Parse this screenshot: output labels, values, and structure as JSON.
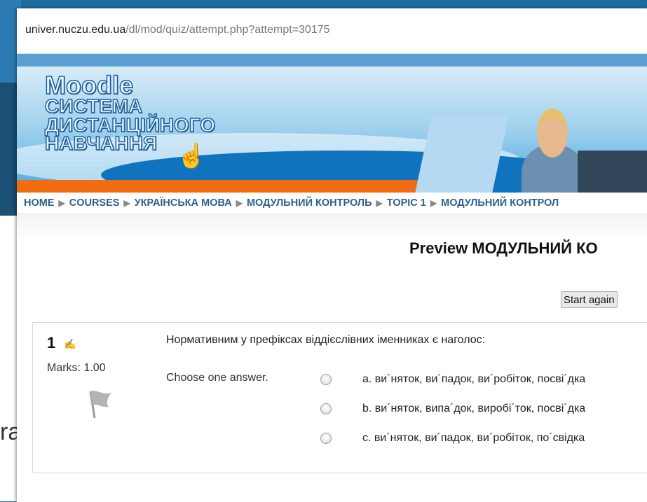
{
  "browser": {
    "url_host": "univer.nuczu.edu.ua",
    "url_path": "/dl/mod/quiz/attempt.php?attempt=30175"
  },
  "banner": {
    "logo_line1": "Moodle",
    "logo_line2": "СИСТЕМА",
    "logo_line3": "ДИСТАНЦІЙНОГО",
    "logo_line4": "НАВЧАННЯ"
  },
  "breadcrumb": [
    "HOME",
    "COURSES",
    "УКРАЇНСЬКА МОВА",
    "МОДУЛЬНИЙ КОНТРОЛЬ",
    "TOPIC 1",
    "МОДУЛЬНИЙ КОНТРОЛ"
  ],
  "page": {
    "title": "Preview МОДУЛЬНИЙ КО",
    "start_again_label": "Start again"
  },
  "question": {
    "number": "1",
    "marks": "Marks: 1.00",
    "text": "Нормативним у префіксах віддієслівних іменниках є наголос:",
    "prompt": "Choose one answer.",
    "options": [
      "a. ви´няток, ви´падок, ви´робіток, посві´дка",
      "b. ви´няток, випа´док, виробі´ток, посві´дка",
      "c. ви´няток, ви´падок, ви´робіток, по´свідка"
    ]
  },
  "background_fragment": "ra"
}
